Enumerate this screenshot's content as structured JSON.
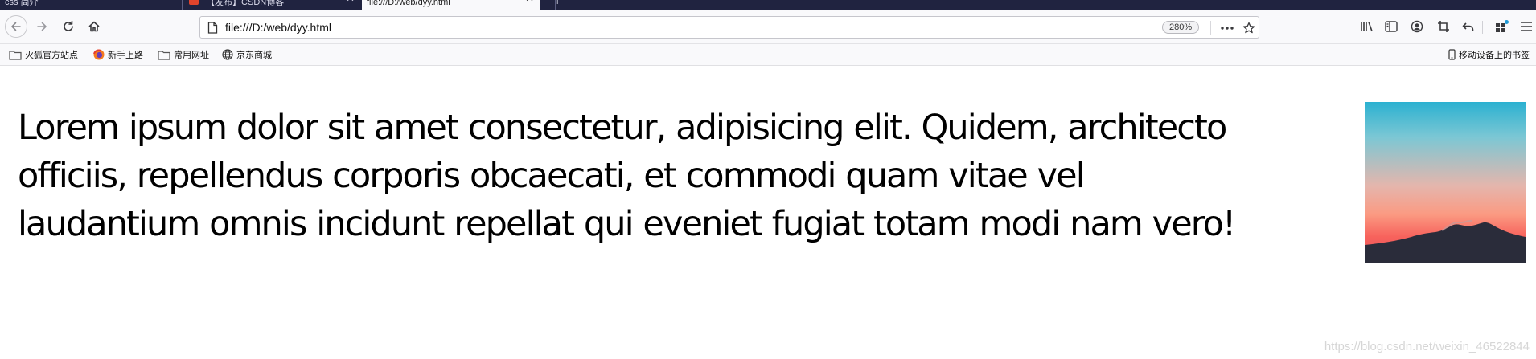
{
  "tabs": [
    {
      "title": "css 简介",
      "active": false
    },
    {
      "title": "【发布】CSDN博客",
      "active": false
    },
    {
      "title": "file:///D:/web/dyy.html",
      "active": true
    }
  ],
  "navbar": {
    "url": "file:///D:/web/dyy.html",
    "zoom": "280%",
    "icons": [
      "back-icon",
      "forward-icon",
      "reload-icon",
      "home-icon",
      "page-icon",
      "more-icon",
      "star-icon",
      "library-icon",
      "sidebar-icon",
      "account-icon",
      "screenshot-icon",
      "undo-icon",
      "extensions-icon",
      "menu-icon"
    ]
  },
  "bookmarks": {
    "items": [
      {
        "label": "火狐官方站点",
        "icon": "folder-icon"
      },
      {
        "label": "新手上路",
        "icon": "firefox-icon"
      },
      {
        "label": "常用网址",
        "icon": "folder-icon"
      },
      {
        "label": "京东商城",
        "icon": "globe-icon"
      }
    ],
    "mobile": "移动设备上的书签"
  },
  "content": {
    "lines": [
      "Lorem ipsum dolor sit amet consectetur, adipisicing elit. Quidem, architecto",
      "officiis, repellendus corporis obcaecati, et commodi quam vitae vel",
      "laudantium omnis incidunt repellat qui eveniet fugiat totam modi nam vero!"
    ]
  },
  "watermark": "https://blog.csdn.net/weixin_46522844",
  "colors": {
    "tabstrip": "#202340",
    "toolbar": "#f9f9fb",
    "image_sky_top": "#2bb1d1",
    "image_sunset": "#f7625c",
    "image_mountain": "#2a2c3a"
  }
}
